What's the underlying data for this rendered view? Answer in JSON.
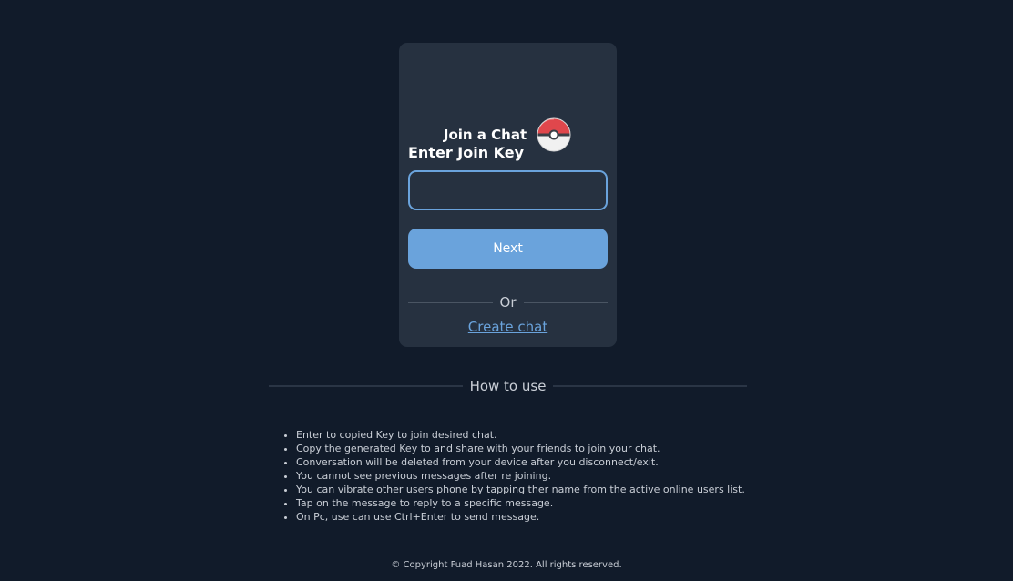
{
  "card": {
    "title": "Join a Chat",
    "field_label": "Enter Join Key",
    "input_value": "",
    "next_label": "Next",
    "or_label": "Or",
    "create_link": "Create chat"
  },
  "howto": {
    "heading": "How to use",
    "tips": [
      "Enter to copied Key to join desired chat.",
      "Copy the generated Key to and share with your friends to join your chat.",
      "Conversation will be deleted from your device after you disconnect/exit.",
      "You cannot see previous messages after re joining.",
      "You can vibrate other users phone by tapping ther name from the active online users list.",
      "Tap on the message to reply to a specific message.",
      "On Pc, use can use Ctrl+Enter to send message."
    ]
  },
  "footer": {
    "copyright": "© Copyright Fuad Hasan 2022. All rights reserved."
  },
  "colors": {
    "background": "#111b2a",
    "card": "#263140",
    "accent": "#6aa3dc",
    "pokeball_red": "#e0474c"
  },
  "icons": {
    "logo": "pokeball-icon"
  }
}
